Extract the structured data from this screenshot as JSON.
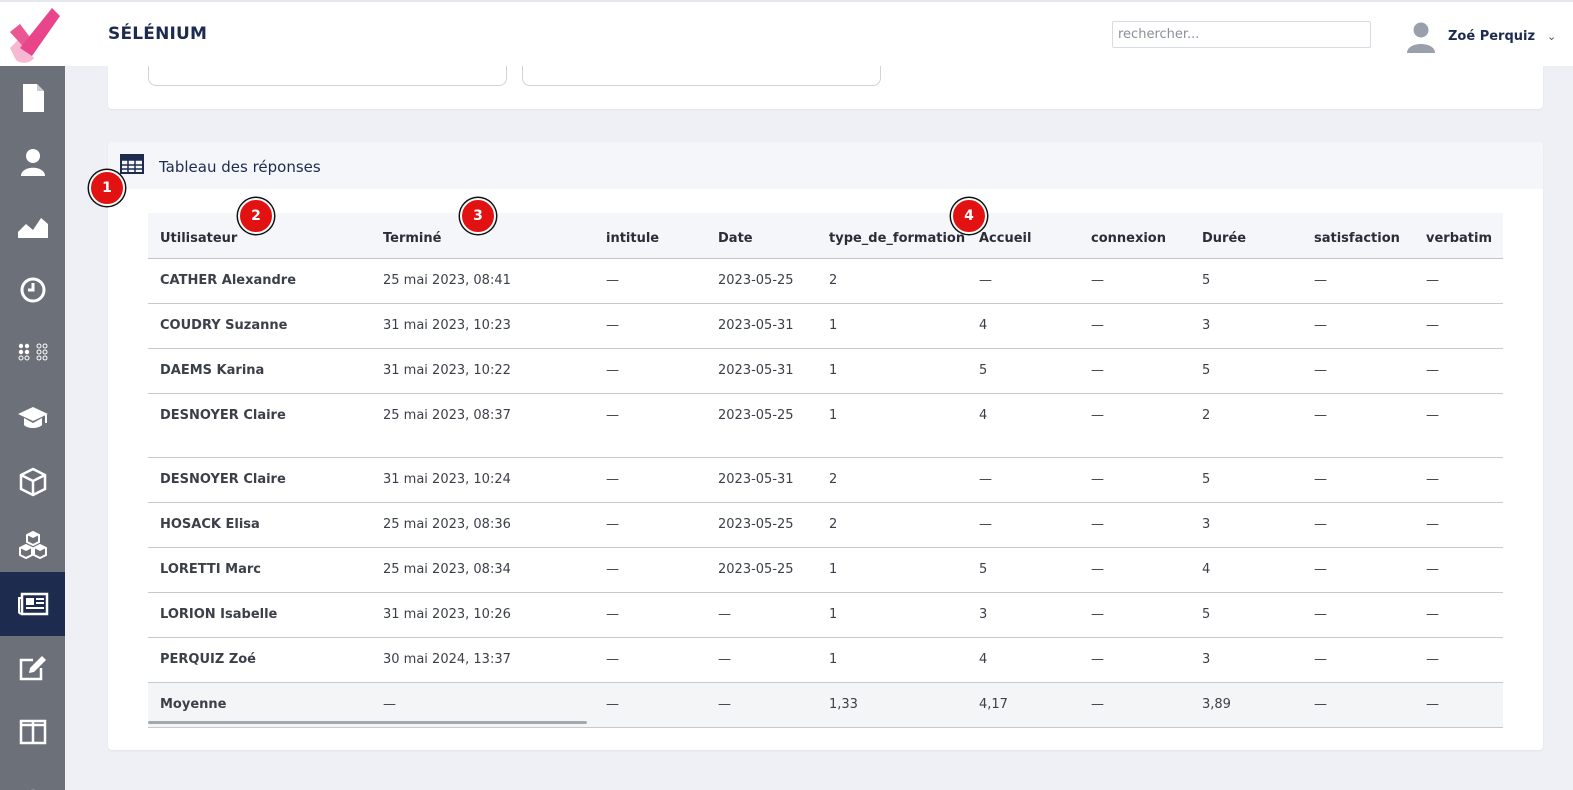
{
  "app": {
    "title": "SÉLÉNIUM"
  },
  "search": {
    "placeholder": "rechercher..."
  },
  "user": {
    "name": "Zoé Perquiz"
  },
  "colors": {
    "accent": "#1d2b4f",
    "sidebar": "#6c7079",
    "logo_pink": "#e8458b",
    "marker": "#e21212"
  },
  "sidebar": {
    "items": [
      {
        "icon": "document-icon"
      },
      {
        "icon": "user-icon"
      },
      {
        "icon": "area-chart-icon"
      },
      {
        "icon": "clock-icon"
      },
      {
        "icon": "grid-dots-icon"
      },
      {
        "icon": "graduation-cap-icon"
      },
      {
        "icon": "cube-icon"
      },
      {
        "icon": "cubes-icon"
      },
      {
        "icon": "newspaper-icon",
        "active": true
      },
      {
        "icon": "edit-icon"
      },
      {
        "icon": "columns-icon"
      },
      {
        "icon": "help-icon"
      }
    ]
  },
  "card": {
    "title": "Tableau des réponses"
  },
  "table": {
    "columns": [
      "Utilisateur",
      "Terminé",
      "intitule",
      "Date",
      "type_de_formation",
      "Accueil",
      "connexion",
      "Durée",
      "satisfaction",
      "verbatim"
    ],
    "rows": [
      [
        "CATHER Alexandre",
        "25 mai 2023, 08:41",
        "—",
        "2023-05-25",
        "2",
        "—",
        "—",
        "5",
        "—",
        "—"
      ],
      [
        "COUDRY Suzanne",
        "31 mai 2023, 10:23",
        "—",
        "2023-05-31",
        "1",
        "4",
        "—",
        "3",
        "—",
        "—"
      ],
      [
        "DAEMS Karina",
        "31 mai 2023, 10:22",
        "—",
        "2023-05-31",
        "1",
        "5",
        "—",
        "5",
        "—",
        "—"
      ],
      [
        "DESNOYER Claire",
        "25 mai 2023, 08:37",
        "—",
        "2023-05-25",
        "1",
        "4",
        "—",
        "2",
        "—",
        "—"
      ],
      [
        "DESNOYER Claire",
        "31 mai 2023, 10:24",
        "—",
        "2023-05-31",
        "2",
        "—",
        "—",
        "5",
        "—",
        "—"
      ],
      [
        "HOSACK Elisa",
        "25 mai 2023, 08:36",
        "—",
        "2023-05-25",
        "2",
        "—",
        "—",
        "3",
        "—",
        "—"
      ],
      [
        "LORETTI Marc",
        "25 mai 2023, 08:34",
        "—",
        "2023-05-25",
        "1",
        "5",
        "—",
        "4",
        "—",
        "—"
      ],
      [
        "LORION Isabelle",
        "31 mai 2023, 10:26",
        "—",
        "—",
        "1",
        "3",
        "—",
        "5",
        "—",
        "—"
      ],
      [
        "PERQUIZ Zoé",
        "30 mai 2024, 13:37",
        "—",
        "—",
        "1",
        "4",
        "—",
        "3",
        "—",
        "—"
      ]
    ],
    "average": [
      "Moyenne",
      "—",
      "—",
      "—",
      "1,33",
      "4,17",
      "—",
      "3,89",
      "—",
      "—"
    ]
  },
  "markers": [
    "1",
    "2",
    "3",
    "4"
  ]
}
